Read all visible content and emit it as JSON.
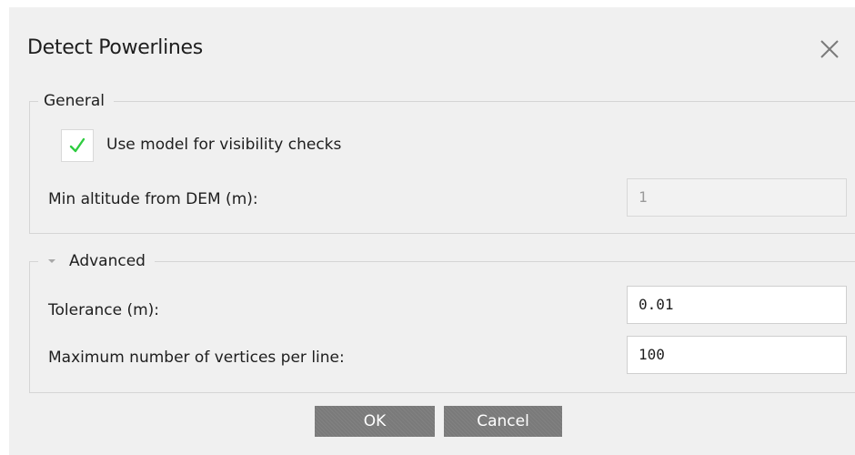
{
  "dialog": {
    "title": "Detect Powerlines",
    "close_icon": "close-icon"
  },
  "general": {
    "legend": "General",
    "use_model_checkbox": {
      "label": "Use model for visibility checks",
      "checked": true,
      "check_color": "#2ecc40"
    },
    "min_altitude": {
      "label": "Min altitude from DEM (m):",
      "value": "1",
      "disabled": true
    }
  },
  "advanced": {
    "legend": "Advanced",
    "expander_icon": "triangle-down-icon",
    "tolerance": {
      "label": "Tolerance (m):",
      "value": "0.01"
    },
    "max_vertices": {
      "label": "Maximum number of vertices per line:",
      "value": "100"
    }
  },
  "buttons": {
    "ok_label": "OK",
    "cancel_label": "Cancel",
    "button_color": "#7a7a7a"
  }
}
